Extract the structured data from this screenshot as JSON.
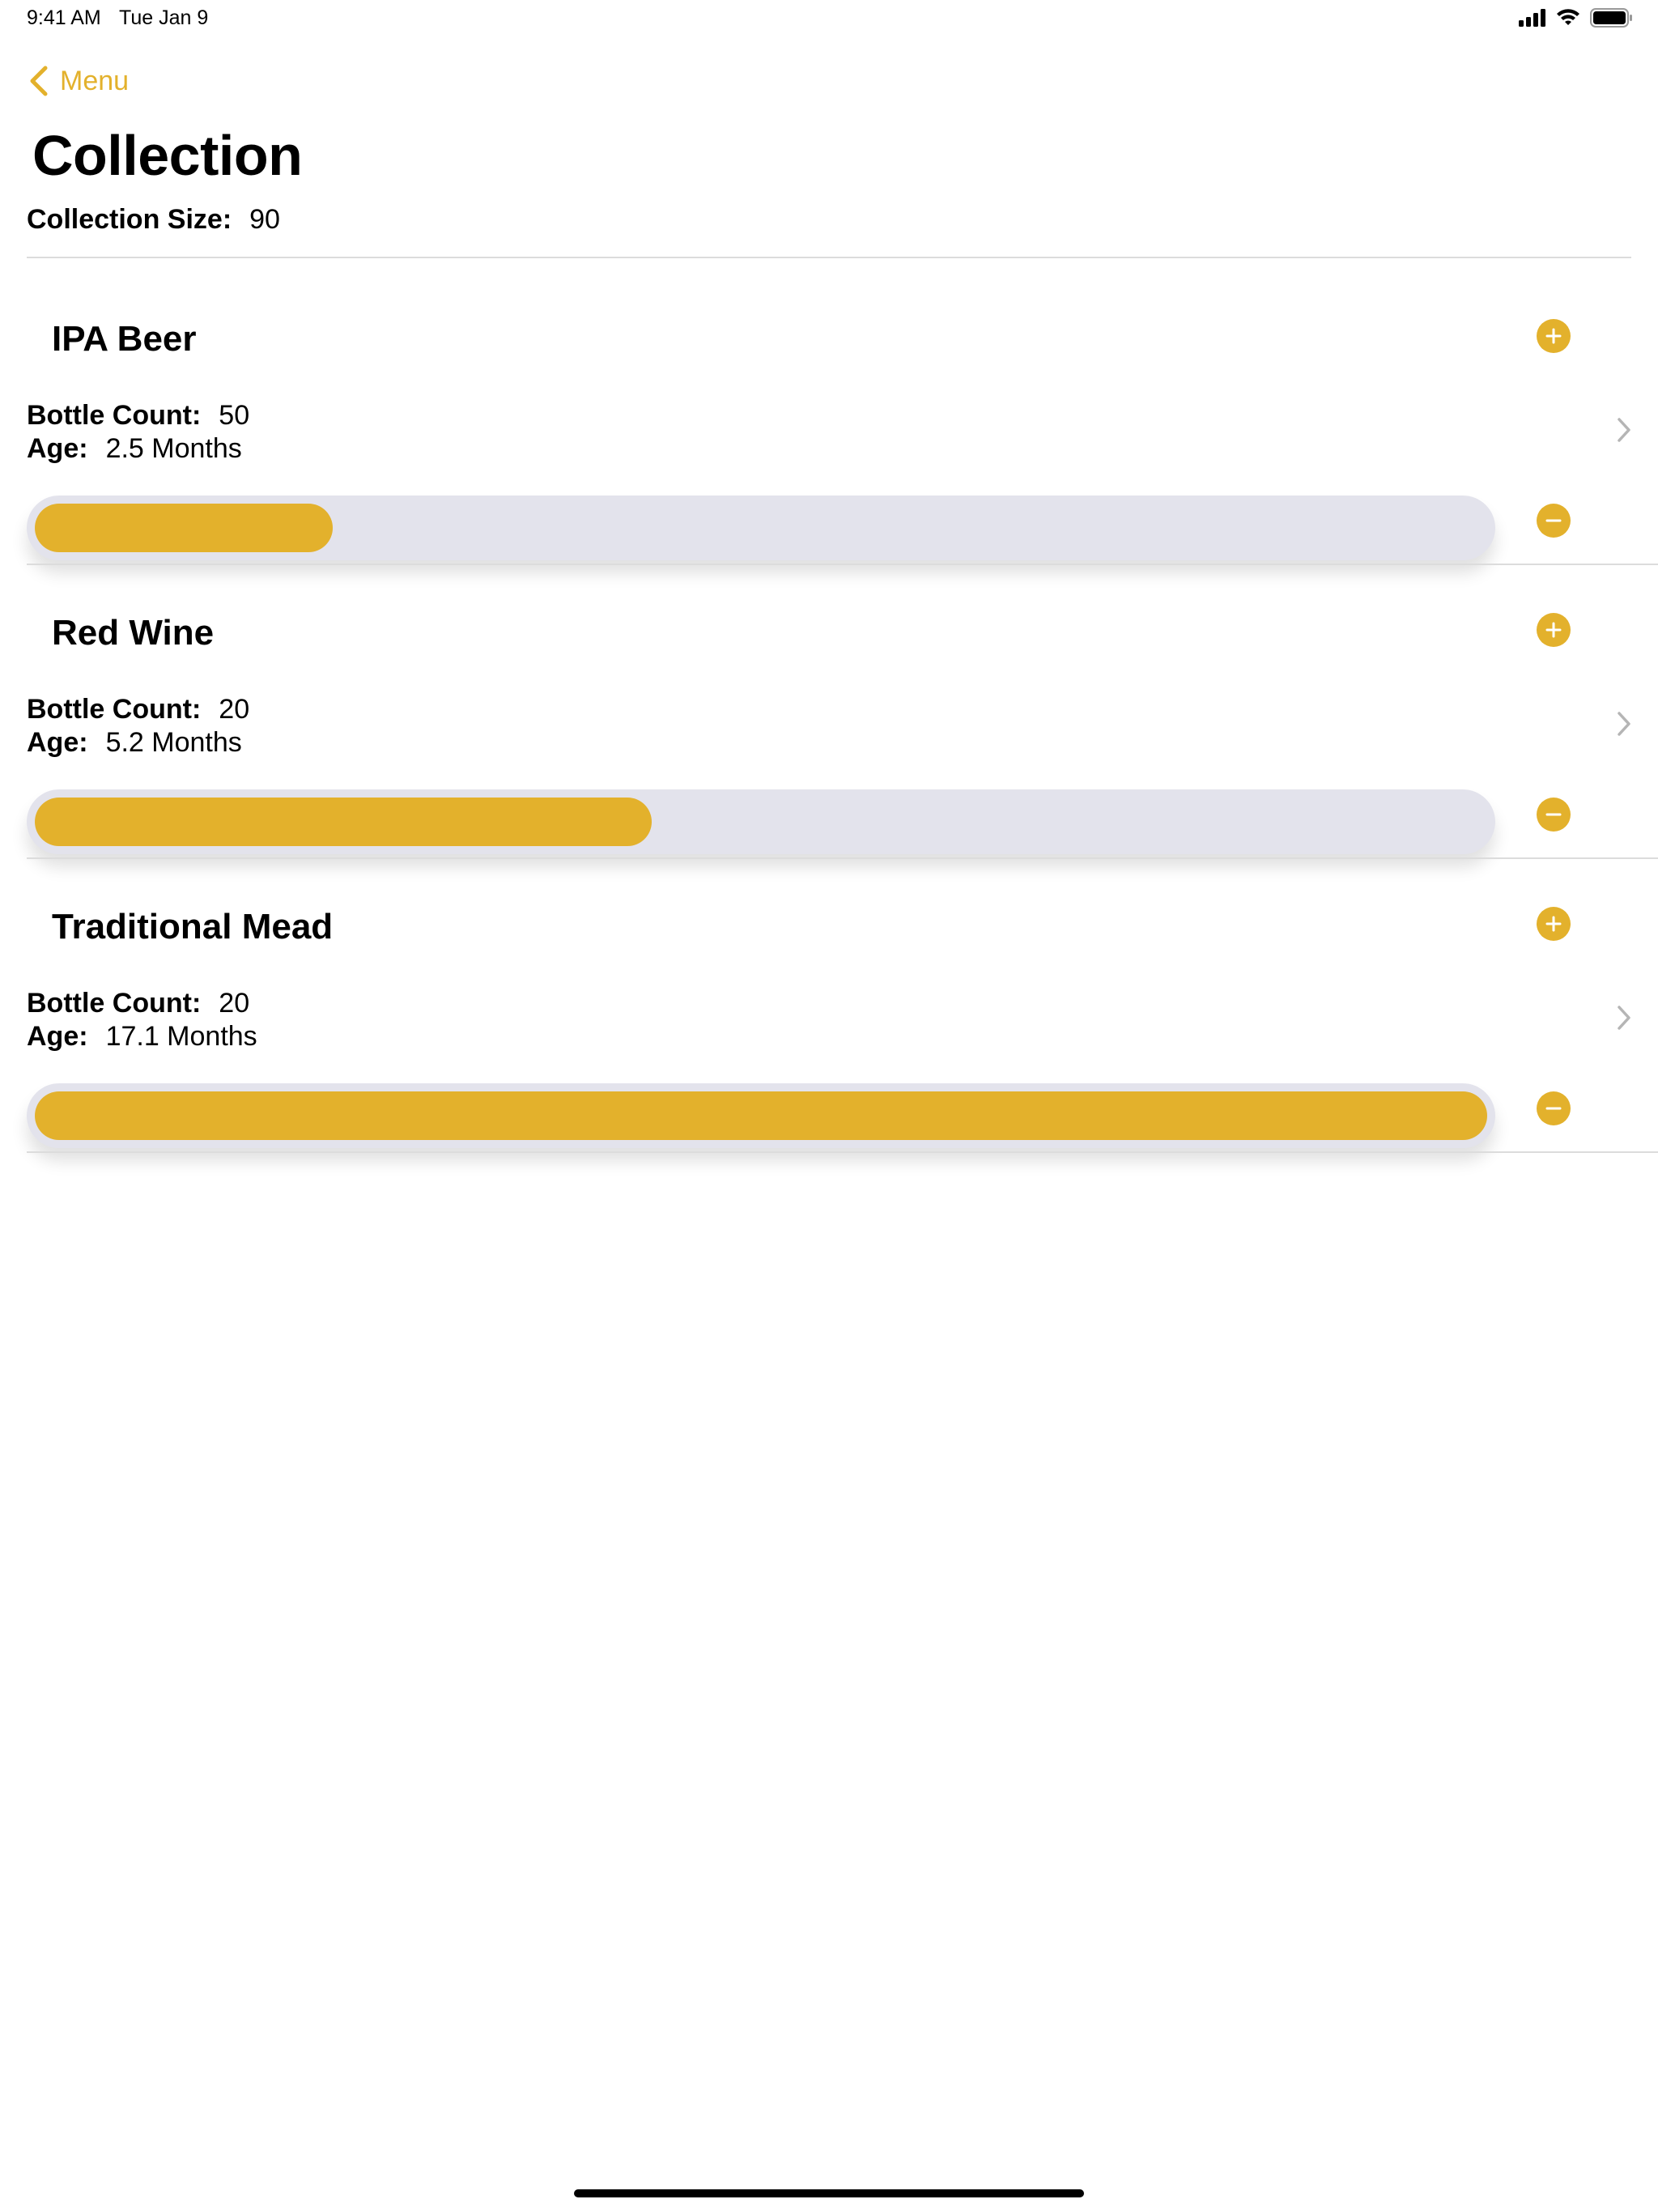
{
  "status_bar": {
    "time": "9:41 AM",
    "date": "Tue Jan 9",
    "icons": [
      "cellular-signal-icon",
      "wifi-icon",
      "battery-icon"
    ]
  },
  "nav": {
    "back_label": "Menu",
    "back_icon": "chevron-left-icon"
  },
  "page": {
    "title": "Collection",
    "collection_size_label": "Collection Size:",
    "collection_size_value": "90"
  },
  "colors": {
    "accent": "#E3B12C",
    "track": "#E3E3EC",
    "divider": "#dcdcdc"
  },
  "sections": [
    {
      "title": "IPA Beer",
      "bottle_count_label": "Bottle Count:",
      "bottle_count": "50",
      "age_label": "Age:",
      "age": "2.5 Months",
      "progress": 0.205
    },
    {
      "title": "Red Wine",
      "bottle_count_label": "Bottle Count:",
      "bottle_count": "20",
      "age_label": "Age:",
      "age": "5.2 Months",
      "progress": 0.425
    },
    {
      "title": "Traditional Mead",
      "bottle_count_label": "Bottle Count:",
      "bottle_count": "20",
      "age_label": "Age:",
      "age": "17.1 Months",
      "progress": 1.0
    }
  ]
}
